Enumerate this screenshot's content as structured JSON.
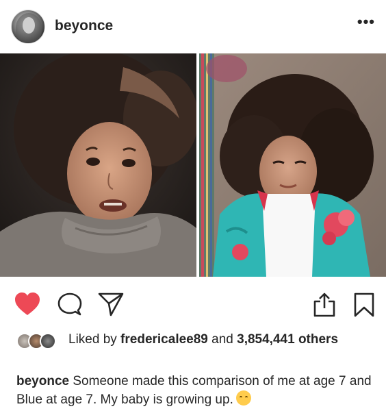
{
  "post": {
    "username": "beyonce",
    "more_label": "•••"
  },
  "likes": {
    "prefix": "Liked by ",
    "user": "fredericalee89",
    "middle": " and ",
    "count": "3,854,441",
    "suffix": " others"
  },
  "caption": {
    "username": "beyonce",
    "text": " Someone made this comparison of me at age 7 and Blue at age 7. My baby is growing up."
  },
  "icons": {
    "like": "heart-icon",
    "comment": "comment-icon",
    "share": "send-icon",
    "upload": "share-upload-icon",
    "save": "bookmark-icon"
  },
  "colors": {
    "liked_heart": "#ed4956",
    "text": "#262626"
  }
}
